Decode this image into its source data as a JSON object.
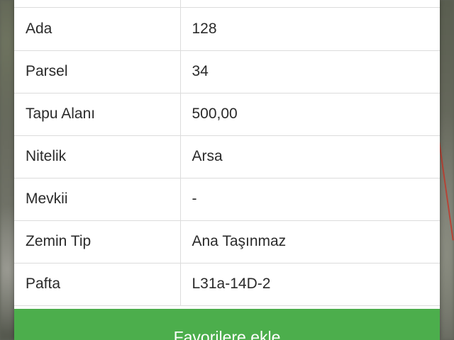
{
  "parcel_info": {
    "rows": [
      {
        "key": "Ada",
        "value": "128"
      },
      {
        "key": "Parsel",
        "value": "34"
      },
      {
        "key": "Tapu Alanı",
        "value": "500,00"
      },
      {
        "key": "Nitelik",
        "value": "Arsa"
      },
      {
        "key": "Mevkii",
        "value": "-"
      },
      {
        "key": "Zemin Tip",
        "value": "Ana Taşınmaz"
      },
      {
        "key": "Pafta",
        "value": "L31a-14D-2"
      }
    ]
  },
  "actions": {
    "favorite_label": "Favorilere ekle"
  },
  "colors": {
    "button_green": "#4cae4c",
    "parcel_border": "#c0392b"
  }
}
